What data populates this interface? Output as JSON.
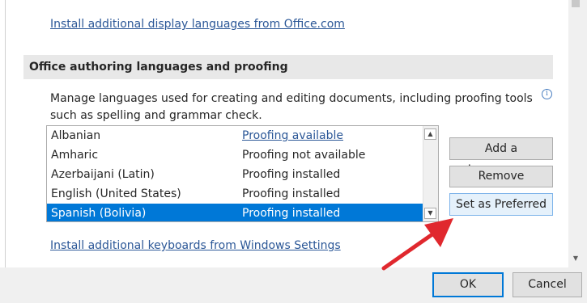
{
  "top_link": "Install additional display languages from Office.com",
  "section_header": "Office authoring languages and proofing",
  "description": "Manage languages used for creating and editing documents, including proofing tools such as spelling and grammar check.",
  "info_icon": "info-icon",
  "languages": [
    {
      "name": "Albanian",
      "status": "Proofing available",
      "status_is_link": true,
      "selected": false
    },
    {
      "name": "Amharic",
      "status": "Proofing not available",
      "status_is_link": false,
      "selected": false
    },
    {
      "name": "Azerbaijani (Latin)",
      "status": "Proofing installed",
      "status_is_link": false,
      "selected": false
    },
    {
      "name": "English (United States)",
      "status": "Proofing installed",
      "status_is_link": false,
      "selected": false
    },
    {
      "name": "Spanish (Bolivia)",
      "status": "Proofing installed",
      "status_is_link": false,
      "selected": true
    }
  ],
  "buttons": {
    "add_language": "Add a Language...",
    "remove": "Remove",
    "set_preferred": "Set as Preferred"
  },
  "bottom_link": "Install additional keyboards from Windows Settings",
  "footer": {
    "ok": "OK",
    "cancel": "Cancel"
  },
  "colors": {
    "selection": "#0078d7",
    "link": "#2b5797",
    "annotation_arrow": "#e0282e"
  }
}
